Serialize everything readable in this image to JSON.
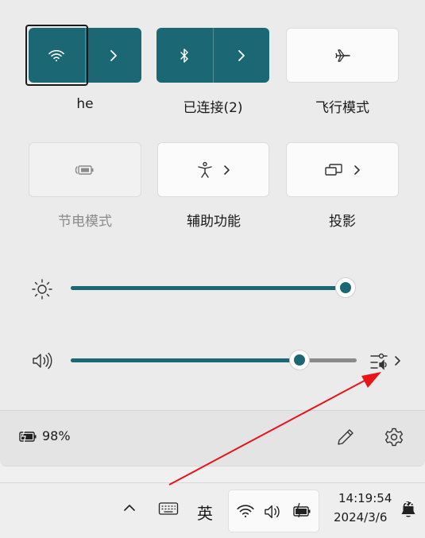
{
  "tiles": {
    "wifi": {
      "label": "he",
      "icon": "wifi-icon",
      "state": "on"
    },
    "bluetooth": {
      "label": "已连接(2)",
      "icon": "bluetooth-icon",
      "state": "on"
    },
    "airplane": {
      "label": "飞行模式",
      "icon": "airplane-icon",
      "state": "off"
    },
    "battery_saver": {
      "label": "节电模式",
      "icon": "battery-saver-icon",
      "state": "disabled"
    },
    "accessibility": {
      "label": "辅助功能",
      "icon": "accessibility-icon",
      "state": "off"
    },
    "project": {
      "label": "投影",
      "icon": "project-icon",
      "state": "off"
    }
  },
  "sliders": {
    "brightness": {
      "value_percent": 100,
      "icon": "brightness-icon"
    },
    "volume": {
      "value_percent": 80,
      "icon": "speaker-icon"
    }
  },
  "footer": {
    "battery_text": "98%",
    "edit_icon": "pencil-icon",
    "settings_icon": "gear-icon"
  },
  "taskbar": {
    "ime_label": "英",
    "time": "14:19:54",
    "date": "2024/3/6",
    "notification_badge": "zZ"
  },
  "colors": {
    "accent": "#1b6874",
    "annotation_arrow": "#e8141a"
  }
}
